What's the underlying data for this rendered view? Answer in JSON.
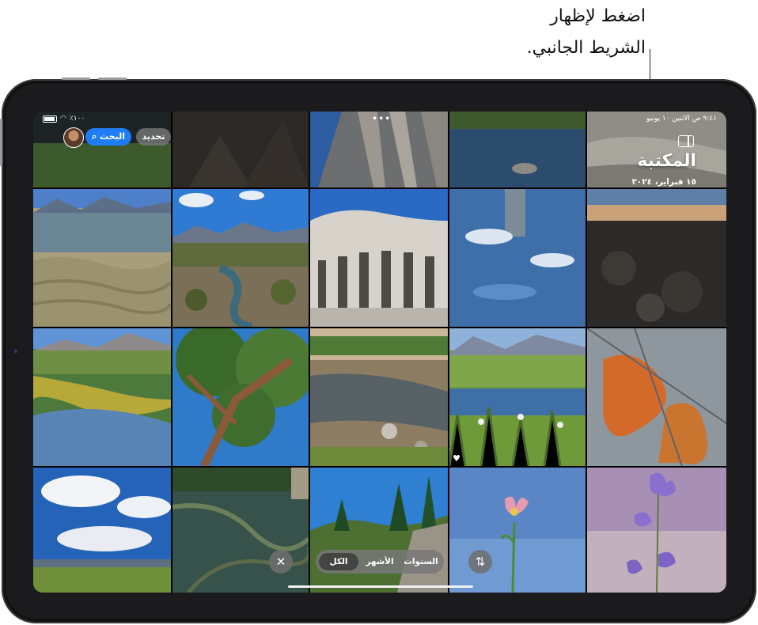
{
  "callout": {
    "line1": "اضغط لإظهار",
    "line2": "الشريط الجانبي."
  },
  "status_bar": {
    "time_date": "٩:٤١ ص   الاثنين ١٠ يونيو",
    "battery": "٪١٠٠"
  },
  "toolbar": {
    "select_label": "تحديد",
    "search_label": "البحث",
    "search_icon": "magnifier-icon",
    "sidebar_icon": "sidebar-toggle-icon",
    "avatar_icon": "profile-avatar"
  },
  "library": {
    "title": "المكتبة",
    "date": "١٥ فبراير، ٢٠٢٤"
  },
  "view_switcher": {
    "options": [
      "السنوات",
      "الأشهر",
      "الكل"
    ],
    "selected": "الكل"
  },
  "controls": {
    "close_icon": "close-icon",
    "sort_icon": "sort-arrows-icon",
    "more_icon": "ellipsis-icon",
    "favorite_icon": "heart-icon"
  },
  "colors": {
    "accent": "#1f7cf2",
    "bezel": "#1b1b1d"
  }
}
